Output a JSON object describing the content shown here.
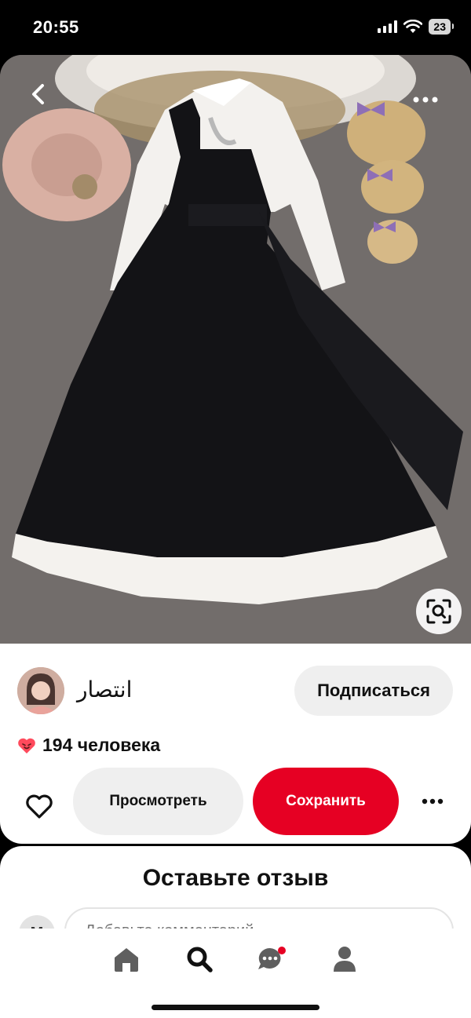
{
  "status_bar": {
    "time": "20:55",
    "battery": "23"
  },
  "pin": {
    "image_description_icon": "dress-photo",
    "back_icon": "chevron-left-icon",
    "more_icon": "more-horizontal-icon",
    "visual_search_icon": "lens-icon"
  },
  "creator": {
    "name": "انتصار",
    "follow_label": "Подписаться"
  },
  "reactions": {
    "text": "194 человека"
  },
  "actions": {
    "view_label": "Просмотреть",
    "save_label": "Сохранить"
  },
  "comments": {
    "title": "Оставьте отзыв",
    "avatar_initial": "М",
    "input_placeholder": "Добавьте комментарий"
  },
  "colors": {
    "accent": "#e60023",
    "button_gray": "#efefef"
  }
}
